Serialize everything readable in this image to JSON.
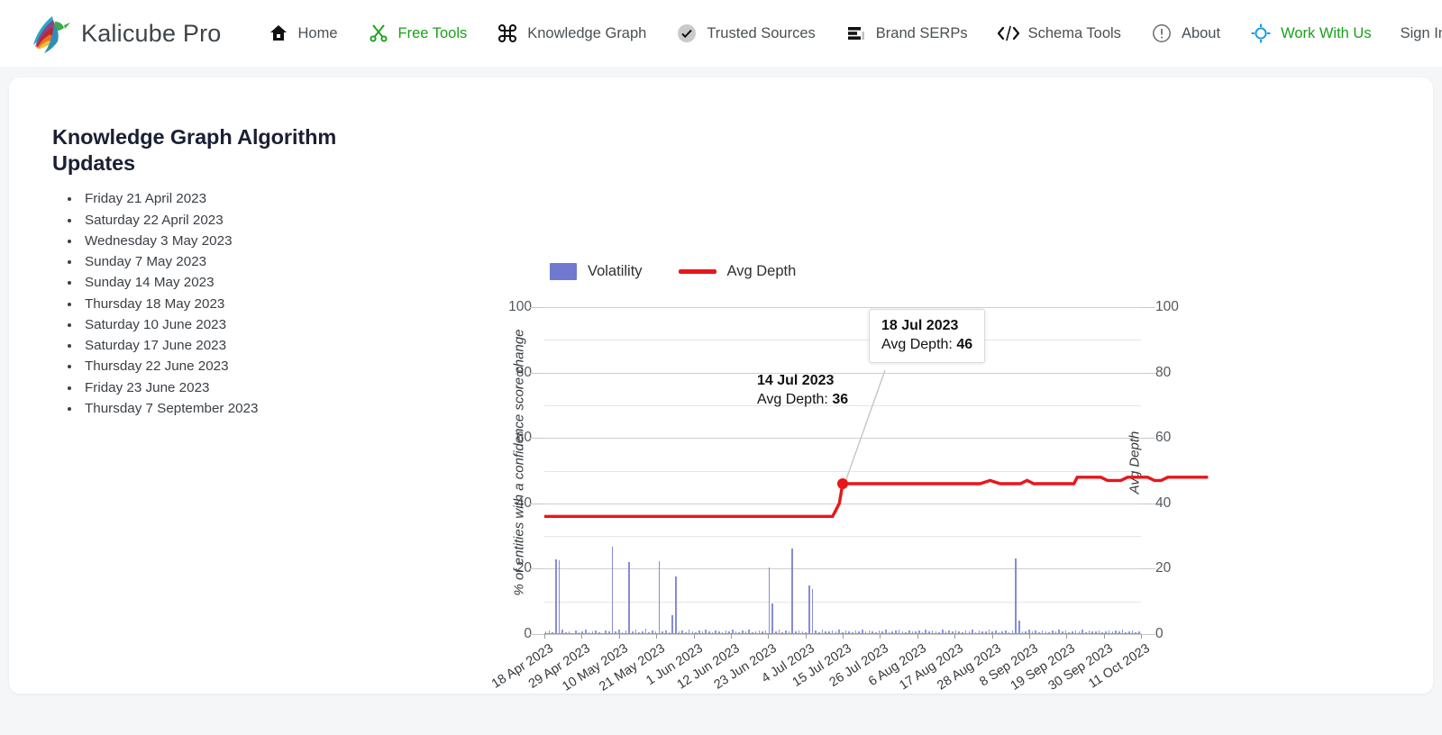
{
  "brand": {
    "name": "Kalicube Pro",
    "logo_icon": "hummingbird-logo-icon"
  },
  "nav": {
    "items": [
      {
        "label": "Home",
        "icon": "home-icon",
        "accent": false
      },
      {
        "label": "Free Tools",
        "icon": "scissors-icon",
        "accent": true
      },
      {
        "label": "Knowledge Graph",
        "icon": "command-icon",
        "accent": false
      },
      {
        "label": "Trusted Sources",
        "icon": "check-circle-icon",
        "accent": false
      },
      {
        "label": "Brand SERPs",
        "icon": "list-bars-icon",
        "accent": false
      },
      {
        "label": "Schema Tools",
        "icon": "code-brackets-icon",
        "accent": false
      },
      {
        "label": "About",
        "icon": "info-circle-icon",
        "accent": false
      },
      {
        "label": "Work With Us",
        "icon": "target-circle-icon",
        "accent": true
      }
    ],
    "signin_label": "Sign In"
  },
  "panel": {
    "title": "Knowledge Graph Algorithm Updates",
    "updates": [
      "Friday 21 April 2023",
      "Saturday 22 April 2023",
      "Wednesday 3 May 2023",
      "Sunday 7 May 2023",
      "Sunday 14 May 2023",
      "Thursday 18 May 2023",
      "Saturday 10 June 2023",
      "Saturday 17 June 2023",
      "Thursday 22 June 2023",
      "Friday 23 June 2023",
      "Thursday 7 September 2023"
    ]
  },
  "colors": {
    "volatility": "#7178cf",
    "avg_depth": "#e8161a",
    "accent_green": "#1aa11a",
    "page_background": "#f4f6f8",
    "card_background": "#ffffff"
  },
  "chart_data": {
    "type": "bar",
    "title": "",
    "xlabel": "",
    "ylabel": "% of entities with a confidence score change",
    "y2label": "Avg Depth",
    "ylim": [
      0,
      100
    ],
    "y2lim": [
      0,
      100
    ],
    "yticks": [
      0,
      20,
      40,
      60,
      80,
      100
    ],
    "y2ticks": [
      0,
      20,
      40,
      60,
      80,
      100
    ],
    "grid": true,
    "legend_position": "top-left",
    "xtick_labels": [
      "18 Apr 2023",
      "29 Apr 2023",
      "10 May 2023",
      "21 May 2023",
      "1 Jun 2023",
      "12 Jun 2023",
      "23 Jun 2023",
      "4 Jul 2023",
      "15 Jul 2023",
      "26 Jul 2023",
      "6 Aug 2023",
      "17 Aug 2023",
      "28 Aug 2023",
      "8 Sep 2023",
      "19 Sep 2023",
      "30 Sep 2023",
      "11 Oct 2023"
    ],
    "series": [
      {
        "name": "Volatility",
        "type": "bar",
        "axis": "left",
        "color": "#7178cf",
        "values": [
          0.8,
          1.2,
          0.6,
          23.0,
          22.6,
          1.4,
          0.5,
          0.9,
          0.4,
          1.1,
          0.6,
          0.8,
          1.5,
          0.5,
          0.7,
          1.0,
          0.6,
          0.4,
          1.2,
          0.8,
          26.8,
          0.9,
          1.4,
          0.6,
          1.0,
          22.0,
          0.7,
          1.3,
          0.5,
          0.9,
          1.6,
          0.6,
          1.1,
          0.8,
          22.4,
          0.7,
          1.2,
          0.5,
          5.8,
          17.6,
          0.9,
          1.0,
          0.6,
          1.3,
          0.8,
          0.5,
          1.1,
          0.7,
          1.4,
          0.9,
          0.6,
          1.2,
          0.8,
          0.5,
          1.0,
          0.7,
          1.5,
          0.9,
          0.6,
          1.1,
          0.8,
          1.3,
          0.5,
          0.9,
          1.0,
          0.7,
          1.2,
          20.3,
          9.4,
          0.8,
          1.5,
          0.6,
          1.0,
          0.9,
          26.3,
          0.7,
          1.2,
          0.8,
          0.5,
          14.8,
          13.9,
          1.0,
          0.6,
          1.3,
          0.9,
          0.7,
          1.1,
          0.8,
          1.4,
          0.5,
          1.0,
          0.9,
          0.6,
          1.2,
          0.8,
          1.5,
          0.7,
          1.0,
          0.9,
          0.6,
          1.1,
          0.8,
          1.3,
          0.5,
          0.9,
          1.0,
          1.4,
          0.7,
          0.6,
          1.2,
          0.8,
          0.9,
          1.0,
          0.5,
          1.3,
          0.7,
          1.1,
          0.8,
          0.6,
          1.5,
          0.9,
          1.0,
          0.7,
          1.2,
          0.8,
          0.5,
          1.1,
          0.9,
          1.3,
          0.6,
          1.0,
          0.8,
          0.7,
          1.4,
          0.9,
          1.1,
          0.5,
          0.8,
          1.2,
          0.6,
          1.0,
          23.2,
          4.2,
          0.9,
          0.7,
          1.3,
          0.8,
          1.0,
          0.6,
          1.1,
          0.9,
          0.5,
          1.2,
          0.8,
          1.4,
          0.7,
          1.0,
          0.6,
          0.9,
          1.1,
          0.8,
          1.3,
          0.5,
          1.0,
          0.7,
          0.9,
          1.2,
          0.6,
          0.8,
          1.0,
          0.9,
          1.1,
          0.7,
          1.3,
          0.5,
          0.8,
          1.0,
          0.6,
          0.9
        ]
      },
      {
        "name": "Avg Depth",
        "type": "line",
        "axis": "right",
        "color": "#e8161a",
        "points": [
          {
            "x": 0,
            "y": 36
          },
          {
            "x": 86,
            "y": 36
          },
          {
            "x": 87,
            "y": 38
          },
          {
            "x": 88,
            "y": 40
          },
          {
            "x": 89,
            "y": 46
          },
          {
            "x": 130,
            "y": 46
          },
          {
            "x": 133,
            "y": 47
          },
          {
            "x": 136,
            "y": 46
          },
          {
            "x": 142,
            "y": 46
          },
          {
            "x": 144,
            "y": 47
          },
          {
            "x": 146,
            "y": 46
          },
          {
            "x": 158,
            "y": 46
          },
          {
            "x": 159,
            "y": 48
          },
          {
            "x": 166,
            "y": 48
          },
          {
            "x": 168,
            "y": 47
          },
          {
            "x": 172,
            "y": 47
          },
          {
            "x": 174,
            "y": 48
          },
          {
            "x": 180,
            "y": 48
          },
          {
            "x": 182,
            "y": 47
          },
          {
            "x": 184,
            "y": 47
          },
          {
            "x": 186,
            "y": 48
          },
          {
            "x": 198,
            "y": 48
          }
        ]
      }
    ],
    "annotations": [
      {
        "id": "ann-14-jul",
        "date": "14 Jul 2023",
        "label": "Avg Depth:",
        "value": "36",
        "boxed": false
      },
      {
        "id": "ann-18-jul",
        "date": "18 Jul 2023",
        "label": "Avg Depth:",
        "value": "46",
        "boxed": true
      }
    ]
  }
}
